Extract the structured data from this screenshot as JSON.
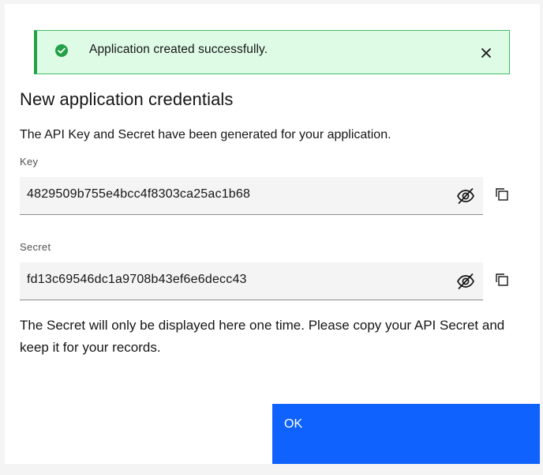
{
  "notification": {
    "message": "Application created successfully.",
    "icon": "checkmark-filled-icon",
    "status_color": "#24a148"
  },
  "dialog": {
    "title": "New application credentials",
    "description": "The API Key and Secret have been generated for your application.",
    "key": {
      "label": "Key",
      "value": "4829509b755e4bcc4f8303ca25ac1b68"
    },
    "secret": {
      "label": "Secret",
      "value": "fd13c69546dc1a9708b43ef6e6decc43"
    },
    "note": "The Secret will only be displayed here one time. Please copy your API Secret and keep it for your records.",
    "ok_label": "OK",
    "primary_color": "#0f62fe"
  }
}
